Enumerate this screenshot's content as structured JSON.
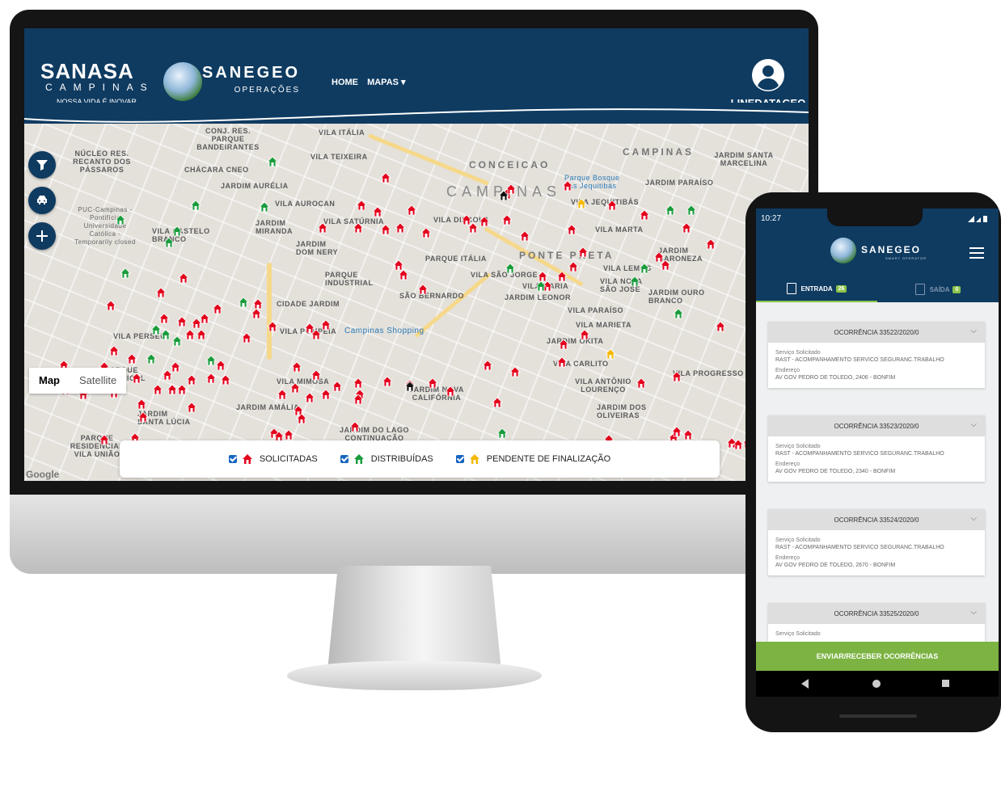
{
  "header": {
    "sanasa": {
      "name": "SANASA",
      "city": "CAMPINAS",
      "slogan": "NOSSA VIDA É INOVAR"
    },
    "sanegeo": {
      "name": "SANEGEO",
      "sub": "OPERAÇÕES"
    },
    "nav": {
      "home": "HOME",
      "mapas": "MAPAS ▾"
    },
    "user": "LINEDATAGEO"
  },
  "map": {
    "maptype": {
      "map": "Map",
      "satellite": "Satellite"
    },
    "labels": [
      "CONJ. RES. PARQUE BANDEIRANTES",
      "VILA ITÁLIA",
      "NÚCLEO RES. RECANTO DOS PÁSSAROS",
      "VILA TEIXEIRA",
      "CHÁCARA CNEO",
      "JARDIM AURÉLIA",
      "VILA AUROCAN",
      "CONCEICAO",
      "CAMPINAS",
      "JARDIM SANTA MARCELINA",
      "JARDIM PARAÍSO",
      "VILA JEQUITIBÁS",
      "VILA SATÚRNIA",
      "VILA DISCOLA",
      "JARDIM MIRANDA",
      "VILA CASTELO BRANCO",
      "JARDIM DOM NERY",
      "PARQUE ITÁLIA",
      "PONTE PRETA",
      "VILA MARTA",
      "JARDIM BARONEZA",
      "VILA LEMOS",
      "PARQUE INDUSTRIAL",
      "VILA SÃO JORGE",
      "VILA MARIA",
      "JARDIM LEONOR",
      "VILA NOVA SÃO JOSÉ",
      "JARDIM OURO BRANCO",
      "SÃO BERNARDO",
      "CIDADE JARDIM",
      "VILA PARAÍSO",
      "VILA MARIETA",
      "VILA POMPÉIA",
      "JARDIM OKITA",
      "VILA CARLITO",
      "VILA MIMOSA",
      "JARDIM NOVA CALIFÓRNIA",
      "VILA ANTÔNIO LOURENÇO",
      "VILA PROGRESSO",
      "JARDIM AMÁLIA",
      "JARDIM DO LAGO CONTINUAÇÃO",
      "PARQUE RESIDENCIAL VILA UNIÃO",
      "JARDIM SANTA LÚCIA",
      "JARDIM DOS OLIVEIRAS",
      "PARQUE TROPICAL",
      "VILA PERSEU"
    ],
    "city_watermark": "Campinas",
    "poi": [
      "Campinas Shopping",
      "Parque Bosque dos Jequitibás",
      "PUC-Campinas - Pontifícia Universidade Católica - Temporarily closed"
    ],
    "google": "Google"
  },
  "legend": {
    "solicitadas": "SOLICITADAS",
    "distribuidas": "DISTRIBUÍDAS",
    "pendente": "PENDENTE DE FINALIZAÇÃO"
  },
  "colors": {
    "solicitada": "#e3001b",
    "distribuida": "#1a9c3c",
    "pendente": "#f5b800",
    "brand": "#0f3b61",
    "accent": "#7cb342"
  },
  "phone": {
    "time": "10:27",
    "brand": "SANEGEO",
    "brand_sub": "SMART OPERATOR",
    "tabs": {
      "entrada": "ENTRADA",
      "entrada_count": "26",
      "saida": "SAÍDA",
      "saida_count": "0"
    },
    "cards": [
      {
        "title": "OCORRÊNCIA 33522/2020/0",
        "servico_label": "Serviço Solicitado",
        "servico": "RAST - ACOMPANHAMENTO SERVICO SEGURANC.TRABALHO",
        "endereco_label": "Endereço",
        "endereco": "AV GOV PEDRO DE TOLEDO, 2406 - BONFIM"
      },
      {
        "title": "OCORRÊNCIA 33523/2020/0",
        "servico_label": "Serviço Solicitado",
        "servico": "RAST - ACOMPANHAMENTO SERVICO SEGURANC.TRABALHO",
        "endereco_label": "Endereço",
        "endereco": "AV GOV PEDRO DE TOLEDO, 2340 - BONFIM"
      },
      {
        "title": "OCORRÊNCIA 33524/2020/0",
        "servico_label": "Serviço Solicitado",
        "servico": "RAST - ACOMPANHAMENTO SERVICO SEGURANC.TRABALHO",
        "endereco_label": "Endereço",
        "endereco": "AV GOV PEDRO DE TOLEDO, 2670 - BONFIM"
      },
      {
        "title": "OCORRÊNCIA 33525/2020/0",
        "servico_label": "Serviço Solicitado",
        "servico": "",
        "endereco_label": "",
        "endereco": ""
      }
    ],
    "send_button": "ENVIAR/RECEBER OCORRÊNCIAS"
  }
}
